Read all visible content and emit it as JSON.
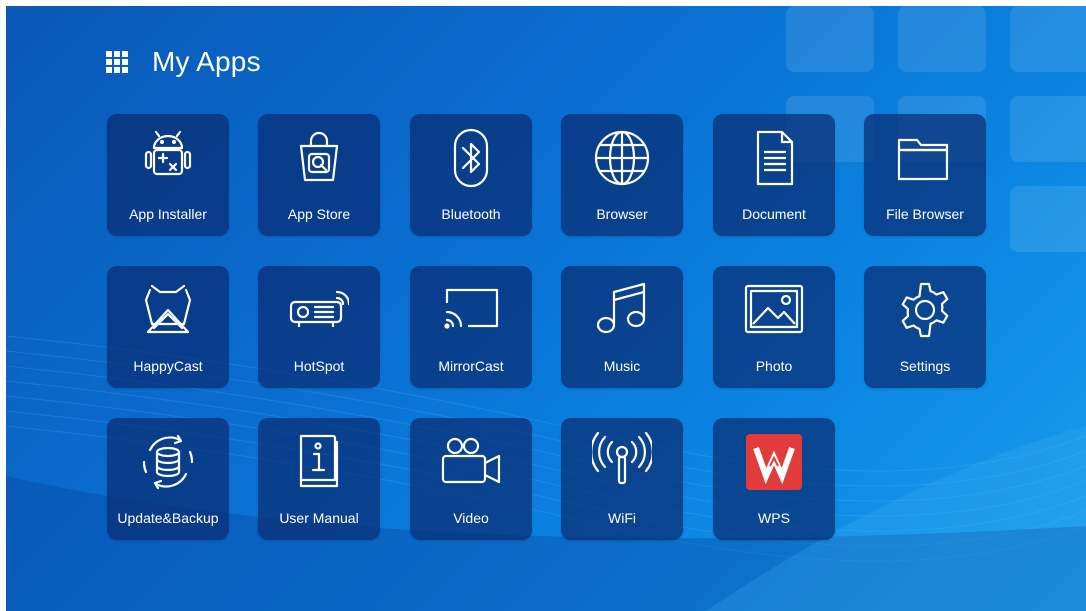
{
  "header": {
    "title": "My Apps",
    "menu_icon": "apps-grid-icon"
  },
  "colors": {
    "background_top": "#0a57b6",
    "background_bottom": "#1aa0ee",
    "tile_bg": "#0a2d73",
    "wps_red": "#e23b3b"
  },
  "apps": [
    {
      "label": "App Installer",
      "icon": "android-installer-icon"
    },
    {
      "label": "App Store",
      "icon": "shopping-bag-icon"
    },
    {
      "label": "Bluetooth",
      "icon": "bluetooth-icon"
    },
    {
      "label": "Browser",
      "icon": "globe-icon"
    },
    {
      "label": "Document",
      "icon": "document-icon"
    },
    {
      "label": "File Browser",
      "icon": "folder-icon"
    },
    {
      "label": "HappyCast",
      "icon": "happycast-icon"
    },
    {
      "label": "HotSpot",
      "icon": "projector-hotspot-icon"
    },
    {
      "label": "MirrorCast",
      "icon": "cast-screen-icon"
    },
    {
      "label": "Music",
      "icon": "music-note-icon"
    },
    {
      "label": "Photo",
      "icon": "photo-icon"
    },
    {
      "label": "Settings",
      "icon": "gear-icon"
    },
    {
      "label": "Update&Backup",
      "icon": "database-sync-icon"
    },
    {
      "label": "User Manual",
      "icon": "info-book-icon"
    },
    {
      "label": "Video",
      "icon": "video-camera-icon"
    },
    {
      "label": "WiFi",
      "icon": "wifi-antenna-icon"
    },
    {
      "label": "WPS",
      "icon": "wps-logo-icon"
    }
  ]
}
